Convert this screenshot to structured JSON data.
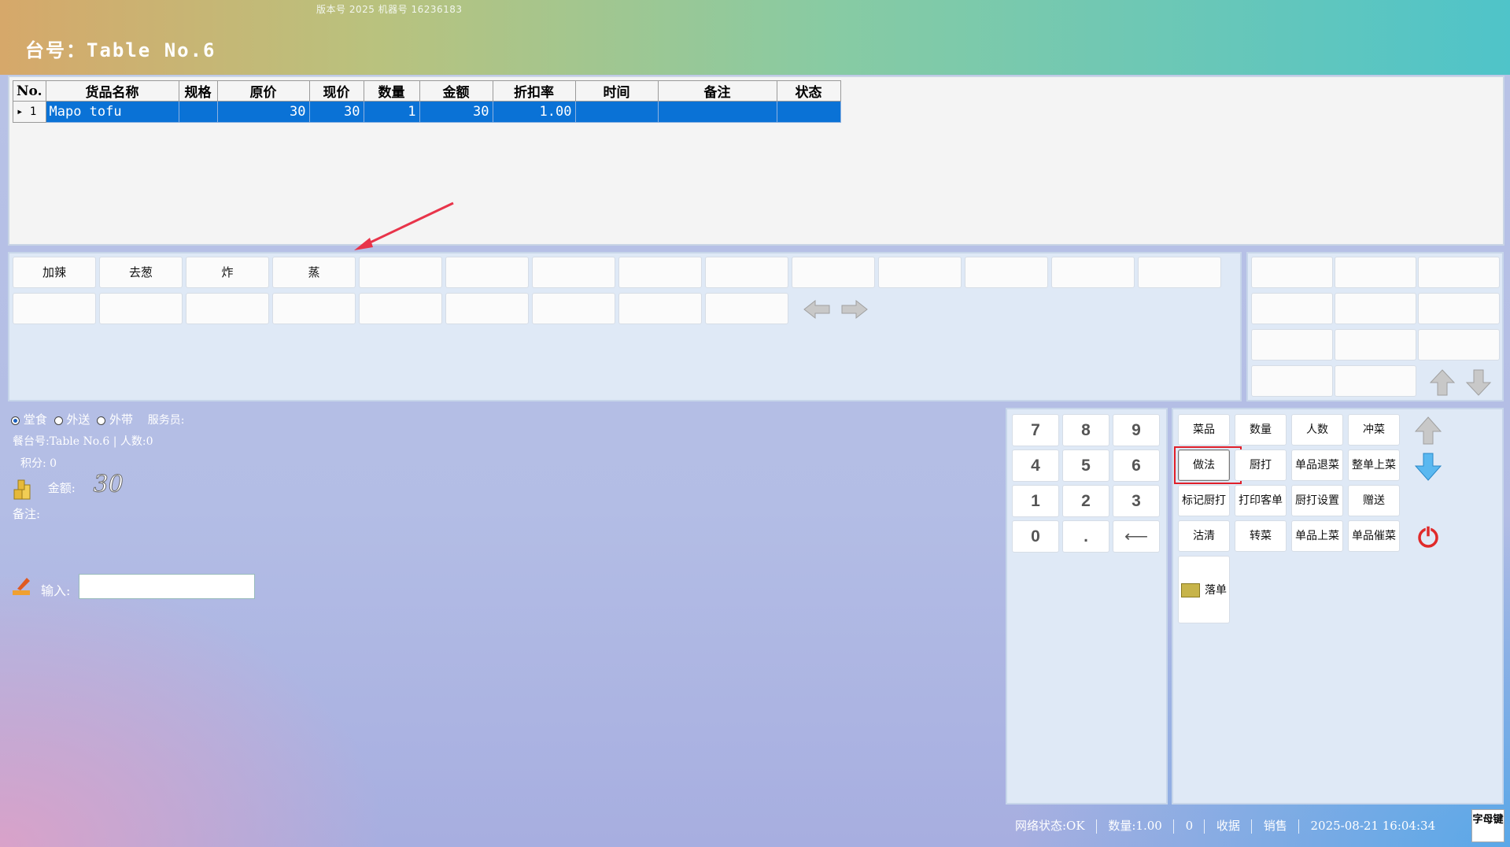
{
  "header": {
    "version": "版本号 2025 机器号 16236183",
    "table_title": "台号：Table No.6"
  },
  "orders": {
    "columns": [
      "No.",
      "货品名称",
      "规格",
      "原价",
      "现价",
      "数量",
      "金额",
      "折扣率",
      "时间",
      "备注",
      "状态"
    ],
    "rows": [
      {
        "no": "1",
        "name": "Mapo tofu",
        "spec": "",
        "orig_price": "30",
        "price": "30",
        "qty": "1",
        "amount": "30",
        "discount": "1.00",
        "time": "",
        "remark": "",
        "status": ""
      }
    ]
  },
  "modifiers": {
    "row1": [
      "加辣",
      "去葱",
      "炸",
      "蒸",
      "",
      "",
      "",
      "",
      "",
      "",
      "",
      "",
      "",
      ""
    ],
    "row2": [
      "",
      "",
      "",
      "",
      "",
      "",
      "",
      "",
      "",
      ""
    ]
  },
  "info": {
    "radio_options": [
      "堂食",
      "外送",
      "外带"
    ],
    "radio_selected": "堂食",
    "waiter_label": "服务员:",
    "table_line": "餐台号:Table No.6 | 人数:0",
    "points": "积分: 0",
    "amount_label": "金额:",
    "amount_value": "30",
    "remark_label": "备注:",
    "input_label": "输入:",
    "input_value": ""
  },
  "keypad": [
    "7",
    "8",
    "9",
    "4",
    "5",
    "6",
    "1",
    "2",
    "3",
    "0",
    ".",
    "⟵"
  ],
  "functions": [
    [
      "菜品",
      "数量",
      "人数",
      "冲菜"
    ],
    [
      "做法",
      "厨打",
      "单品退菜",
      "整单上菜"
    ],
    [
      "标记厨打",
      "打印客单",
      "厨打设置",
      "赠送"
    ],
    [
      "沽清",
      "转菜",
      "单品上菜",
      "单品催菜"
    ]
  ],
  "order_button": "落单",
  "status": {
    "network": "网络状态:OK",
    "qty": "数量:1.00",
    "count": "0",
    "cashier": "收据",
    "sale": "销售",
    "datetime": "2025-08-21 16:04:34",
    "keyboard": "字母键"
  },
  "colors": {
    "selected_row": "#0a72d6",
    "highlight_border": "#e0202a",
    "arrow_annotation": "#e8344a"
  }
}
